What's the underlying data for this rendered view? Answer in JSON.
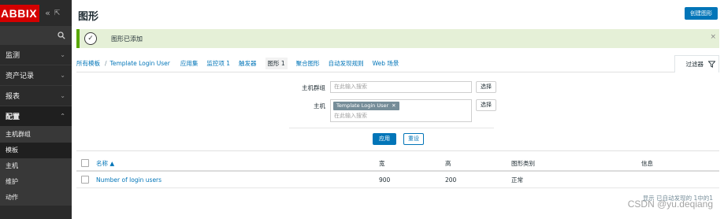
{
  "sidebar": {
    "logo": "ABBIX",
    "collapse_icon": "«",
    "expand_icon": "⇱",
    "menu": [
      {
        "label": "监测"
      },
      {
        "label": "资产记录"
      },
      {
        "label": "报表"
      },
      {
        "label": "配置"
      }
    ],
    "submenu": [
      {
        "label": "主机群组"
      },
      {
        "label": "模板"
      },
      {
        "label": "主机"
      },
      {
        "label": "维护"
      },
      {
        "label": "动作"
      }
    ]
  },
  "header": {
    "title": "图形",
    "create_button": "创建图形"
  },
  "message": {
    "text": "图形已添加"
  },
  "nav": {
    "breadcrumb_all": "所有模板",
    "breadcrumb_sep": "/",
    "breadcrumb_template": "Template Login User",
    "tabs": [
      {
        "label": "应用集"
      },
      {
        "label": "监控项 1"
      },
      {
        "label": "触发器"
      },
      {
        "label": "图形 1"
      },
      {
        "label": "聚合图形"
      },
      {
        "label": "自动发现规则"
      },
      {
        "label": "Web 场景"
      }
    ],
    "filter_label": "过滤器"
  },
  "filter": {
    "host_group_label": "主机群组",
    "host_group_placeholder": "在此输入搜索",
    "host_label": "主机",
    "host_chip": "Template Login User",
    "host_placeholder": "在此输入搜索",
    "select_button": "选择",
    "apply_button": "应用",
    "reset_button": "重设"
  },
  "table": {
    "columns": [
      "名称 ▲",
      "宽",
      "高",
      "图形类别",
      "信息"
    ],
    "rows": [
      {
        "name": "Number of login users",
        "width": "900",
        "height": "200",
        "type": "正常",
        "info": ""
      }
    ]
  },
  "footer": {
    "count": "显示 已自动发现的 1中的1"
  },
  "watermark": "CSDN @yu.deqiang"
}
